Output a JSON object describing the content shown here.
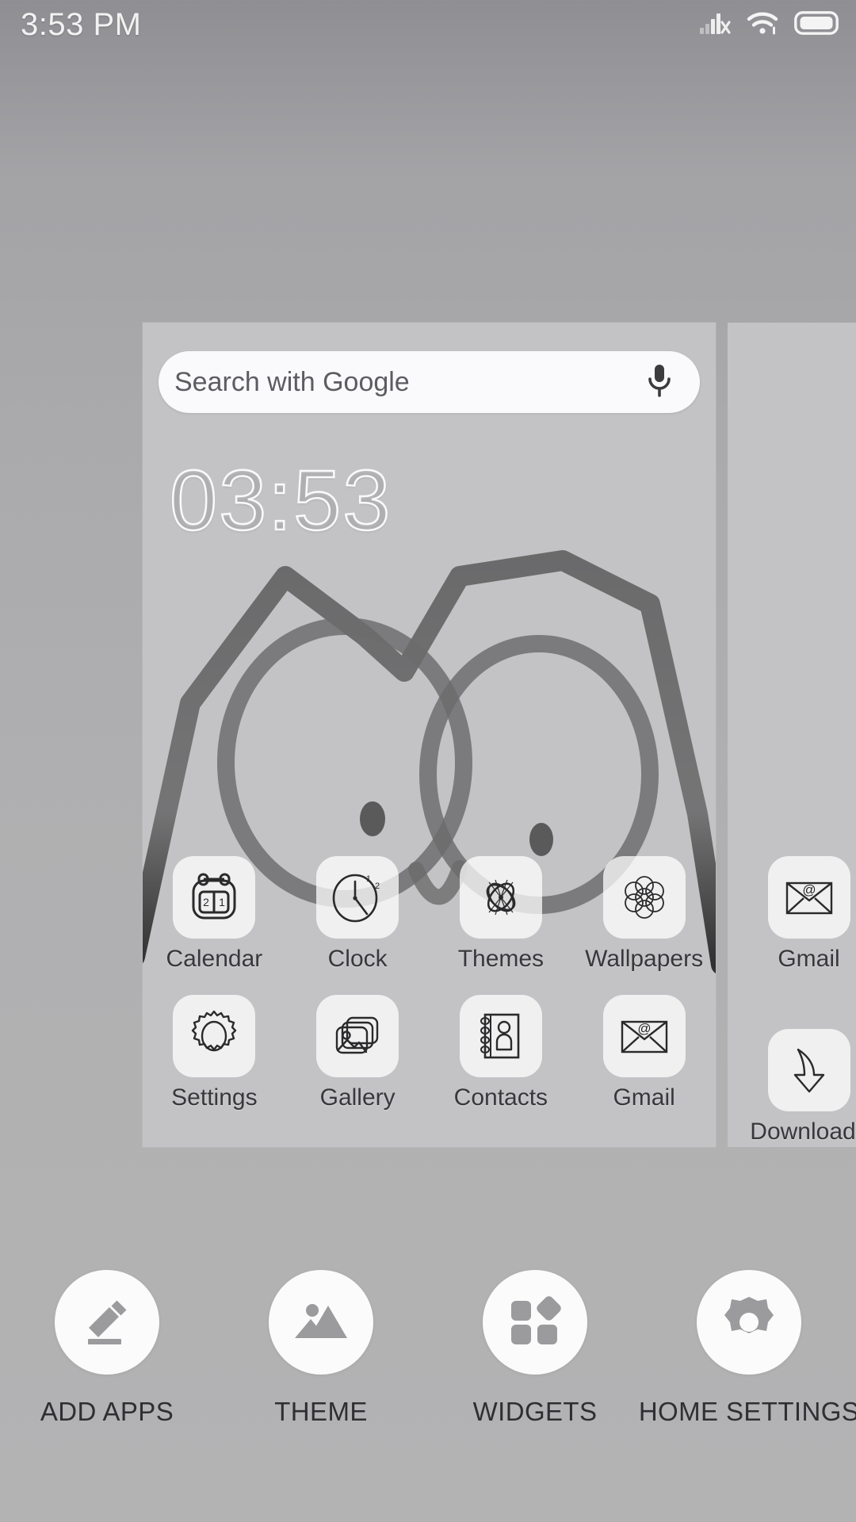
{
  "status_bar": {
    "time": "3:53 PM",
    "icons": [
      {
        "name": "cellular-signal-no-sim-icon",
        "glyph": "signal-x"
      },
      {
        "name": "wifi-icon",
        "glyph": "wifi"
      },
      {
        "name": "battery-full-icon",
        "glyph": "battery"
      }
    ]
  },
  "preview": {
    "search": {
      "placeholder": "Search with Google",
      "mic_icon": "microphone-icon"
    },
    "clock_widget": {
      "time": "03:53"
    },
    "wallpaper": {
      "description": "hand-drawn owl face with zigzag crown"
    },
    "app_rows": [
      [
        {
          "label": "Calendar",
          "icon": "calendar-icon",
          "badge_left": "2",
          "badge_right": "1"
        },
        {
          "label": "Clock",
          "icon": "clock-icon",
          "mark_1": "1",
          "mark_2": "2"
        },
        {
          "label": "Themes",
          "icon": "themes-flower-icon"
        },
        {
          "label": "Wallpapers",
          "icon": "wallpapers-rosette-icon"
        }
      ],
      [
        {
          "label": "Settings",
          "icon": "settings-gear-icon"
        },
        {
          "label": "Gallery",
          "icon": "gallery-photos-icon"
        },
        {
          "label": "Contacts",
          "icon": "contacts-book-icon"
        },
        {
          "label": "Gmail",
          "icon": "gmail-envelope-icon"
        }
      ]
    ],
    "next_page_apps": [
      {
        "label": "Gmail",
        "icon": "gmail-envelope-icon"
      },
      {
        "label": "Downloads",
        "icon": "downloads-arrow-icon"
      }
    ]
  },
  "toolbar": {
    "items": [
      {
        "label": "ADD APPS",
        "icon": "pencil-icon"
      },
      {
        "label": "THEME",
        "icon": "image-icon"
      },
      {
        "label": "WIDGETS",
        "icon": "widgets-icon"
      },
      {
        "label": "HOME SETTINGS",
        "icon": "gear-icon"
      }
    ]
  },
  "colors": {
    "background_top": "#8f8f93",
    "background_bottom": "#b3b3b4",
    "card": "#c3c3c5",
    "search_bar": "#faf9fb",
    "tile": "rgba(255,255,255,0.74)",
    "toolbar_circle": "#fbfbfb",
    "label_text": "#38383c"
  }
}
